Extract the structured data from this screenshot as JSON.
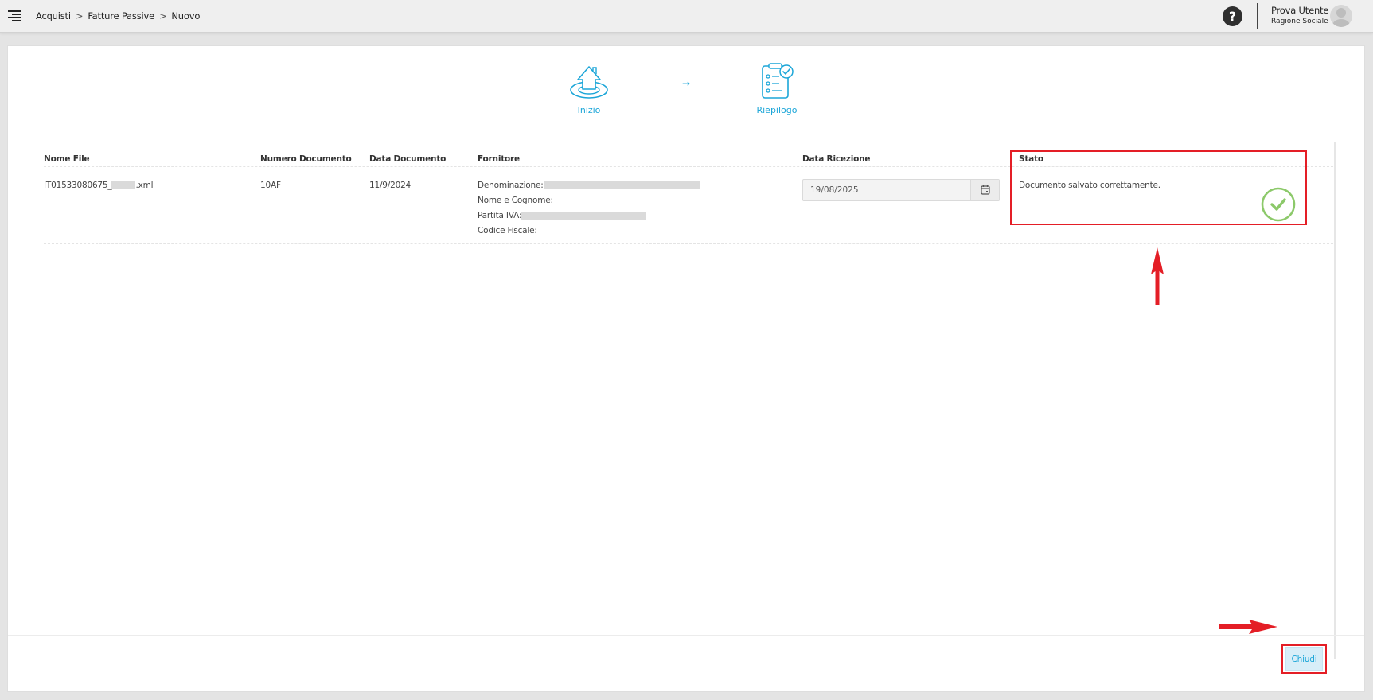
{
  "header": {
    "breadcrumb": [
      "Acquisti",
      "Fatture Passive",
      "Nuovo"
    ],
    "separator": ">",
    "help_symbol": "?",
    "user_name": "Prova Utente",
    "user_company": "Ragione Sociale"
  },
  "steps": [
    {
      "label": "Inizio",
      "icon": "home-upload-icon"
    },
    {
      "label": "Riepilogo",
      "icon": "checklist-icon"
    }
  ],
  "step_arrow": "→",
  "table": {
    "headers": [
      "Nome File",
      "Numero Documento",
      "Data Documento",
      "Fornitore",
      "Data Ricezione",
      "Stato"
    ],
    "row": {
      "file_prefix": "IT01533080675_",
      "file_suffix": ".xml",
      "numero": "10AF",
      "data_documento": "11/9/2024",
      "fornitore": {
        "denominazione": "Denominazione:",
        "nome_cognome": "Nome e Cognome:",
        "partita_iva": "Partita IVA:",
        "codice_fiscale": "Codice Fiscale:"
      },
      "data_ricezione": "19/08/2025",
      "stato": "Documento salvato correttamente."
    }
  },
  "footer": {
    "close_label": "Chiudi"
  },
  "colors": {
    "accent": "#1ca6d8",
    "success": "#8cc96a",
    "annotation": "#e41e26"
  }
}
